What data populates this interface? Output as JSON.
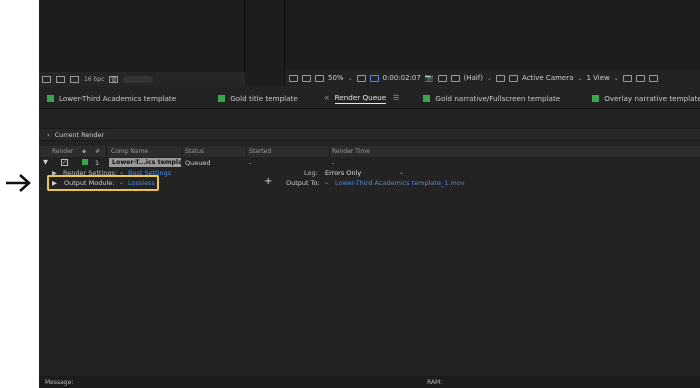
{
  "project_panel": {
    "bit_depth": "16 bpc"
  },
  "viewer_bar": {
    "zoom": "50%",
    "timecode": "0:00:02:07",
    "resolution": "(Half)",
    "camera": "Active Camera",
    "views": "1 View"
  },
  "tabs": [
    {
      "label": "Lower-Third Academics template",
      "color": "#3aa64a"
    },
    {
      "label": "Gold title template",
      "color": "#3aa64a"
    },
    {
      "label": "Render Queue",
      "active": true
    },
    {
      "label": "Gold narrative/Fullscreen template",
      "color": "#3aa64a"
    },
    {
      "label": "Overlay narrative template",
      "color": "#3aa64a"
    }
  ],
  "render_queue": {
    "current_render": "Current Render",
    "columns": {
      "render": "Render",
      "number": "#",
      "comp_name": "Comp Name",
      "status": "Status",
      "started": "Started",
      "render_time": "Render Time"
    },
    "item": {
      "number": "1",
      "comp_name": "Lower-T...ics template",
      "status": "Queued",
      "started": "-",
      "render_time": "-"
    },
    "render_settings": {
      "label": "Render Settings:",
      "value": "Best Settings",
      "log_label": "Log:",
      "log_value": "Errors Only"
    },
    "output_module": {
      "label": "Output Module:",
      "value": "Lossless",
      "output_to_label": "Output To:",
      "output_to_value": "Lower-Third Academics template_1.mov"
    }
  },
  "bottom_bar": {
    "message_label": "Message:",
    "ram_label": "RAM:"
  },
  "colors": {
    "highlight": "#e8c64b",
    "link": "#4f8ddc",
    "label_green": "#3aa64a"
  }
}
